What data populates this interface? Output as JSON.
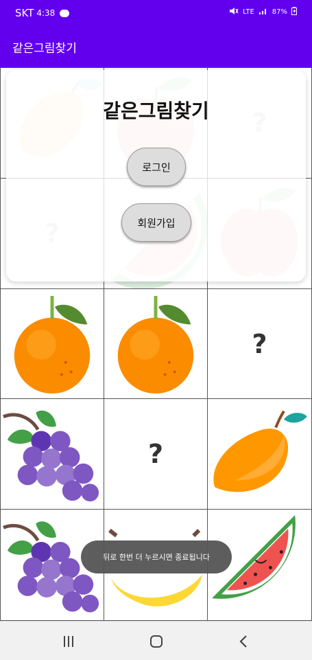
{
  "status_bar": {
    "carrier": "SKT",
    "time": "4:38",
    "network": "LTE",
    "battery": "87%"
  },
  "app_bar": {
    "title": "같은그림찾기"
  },
  "dialog": {
    "title": "같은그림찾기",
    "login_label": "로그인",
    "signup_label": "회원가입"
  },
  "grid": {
    "rows": [
      [
        "mango",
        "apple",
        "?"
      ],
      [
        "?",
        "watermelon",
        "apple"
      ],
      [
        "orange",
        "orange",
        "?"
      ],
      [
        "grapes",
        "?",
        "mango"
      ],
      [
        "grapes",
        "banana",
        "watermelon"
      ]
    ]
  },
  "toast": {
    "message": "뒤로 한번 더 누르시면 종료됩니다"
  },
  "nav_bar": {
    "items": [
      "recents-icon",
      "home-icon",
      "back-icon"
    ]
  },
  "colors": {
    "primary": "#6200ee"
  }
}
